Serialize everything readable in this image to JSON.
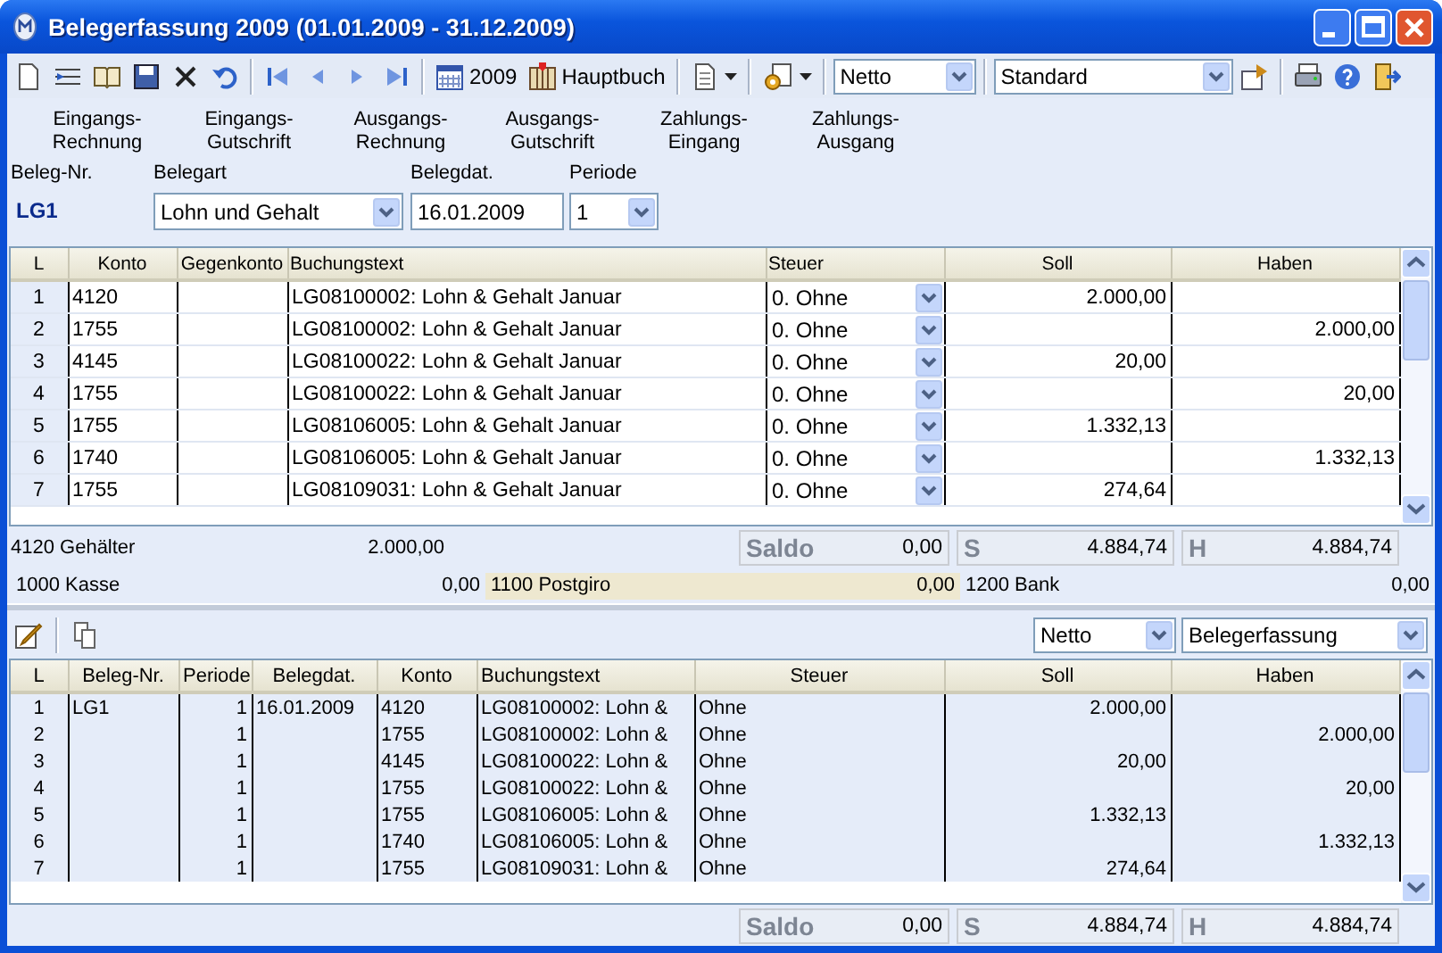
{
  "window": {
    "title": "Belegerfassung 2009 (01.01.2009 - 31.12.2009)"
  },
  "toolbar": {
    "year_button": "2009",
    "ledger_button": "Hauptbuch",
    "mode_select": "Netto",
    "layout_select": "Standard"
  },
  "document_types": [
    "Eingangs-Rechnung",
    "Eingangs-Gutschrift",
    "Ausgangs-Rechnung",
    "Ausgangs-Gutschrift",
    "Zahlungs-Eingang",
    "Zahlungs-Ausgang"
  ],
  "form": {
    "beleg_nr": {
      "label": "Beleg-Nr.",
      "value": "LG1"
    },
    "belegart": {
      "label": "Belegart",
      "value": "Lohn und Gehalt"
    },
    "belegdat": {
      "label": "Belegdat.",
      "value": "16.01.2009"
    },
    "periode": {
      "label": "Periode",
      "value": "1"
    }
  },
  "entry_table": {
    "columns": [
      "L",
      "Konto",
      "Gegenkonto",
      "Buchungstext",
      "Steuer",
      "Soll",
      "Haben"
    ],
    "rows": [
      {
        "l": "1",
        "konto": "4120",
        "gegenkonto": "",
        "text": "LG08100002: Lohn & Gehalt Januar",
        "steuer": "0. Ohne",
        "soll": "2.000,00",
        "haben": ""
      },
      {
        "l": "2",
        "konto": "1755",
        "gegenkonto": "",
        "text": "LG08100002: Lohn & Gehalt Januar",
        "steuer": "0. Ohne",
        "soll": "",
        "haben": "2.000,00"
      },
      {
        "l": "3",
        "konto": "4145",
        "gegenkonto": "",
        "text": "LG08100022: Lohn & Gehalt Januar",
        "steuer": "0. Ohne",
        "soll": "20,00",
        "haben": ""
      },
      {
        "l": "4",
        "konto": "1755",
        "gegenkonto": "",
        "text": "LG08100022: Lohn & Gehalt Januar",
        "steuer": "0. Ohne",
        "soll": "",
        "haben": "20,00"
      },
      {
        "l": "5",
        "konto": "1755",
        "gegenkonto": "",
        "text": "LG08106005: Lohn & Gehalt Januar",
        "steuer": "0. Ohne",
        "soll": "1.332,13",
        "haben": ""
      },
      {
        "l": "6",
        "konto": "1740",
        "gegenkonto": "",
        "text": "LG08106005: Lohn & Gehalt Januar",
        "steuer": "0. Ohne",
        "soll": "",
        "haben": "1.332,13"
      },
      {
        "l": "7",
        "konto": "1755",
        "gegenkonto": "",
        "text": "LG08109031: Lohn & Gehalt Januar",
        "steuer": "0. Ohne",
        "soll": "274,64",
        "haben": ""
      }
    ]
  },
  "account_balance": {
    "label": "4120 Gehälter",
    "value": "2.000,00"
  },
  "entry_totals": {
    "saldo": {
      "label": "Saldo",
      "value": "0,00"
    },
    "soll": {
      "label": "S",
      "value": "4.884,74"
    },
    "haben": {
      "label": "H",
      "value": "4.884,74"
    }
  },
  "cash_accounts": [
    {
      "label": "1000 Kasse",
      "value": "0,00",
      "selected": false
    },
    {
      "label": "1100 Postgiro",
      "value": "0,00",
      "selected": true
    },
    {
      "label": "1200 Bank",
      "value": "0,00",
      "selected": false
    }
  ],
  "journal_toolbar": {
    "mode_select": "Netto",
    "view_select": "Belegerfassung"
  },
  "journal_table": {
    "columns": [
      "L",
      "Beleg-Nr.",
      "Periode",
      "Belegdat.",
      "Konto",
      "Buchungstext",
      "Steuer",
      "Soll",
      "Haben"
    ],
    "rows": [
      {
        "l": "1",
        "beleg_nr": "LG1",
        "periode": "1",
        "belegdat": "16.01.2009",
        "konto": "4120",
        "text": "LG08100002: Lohn &",
        "steuer": "Ohne",
        "soll": "2.000,00",
        "haben": ""
      },
      {
        "l": "2",
        "beleg_nr": "",
        "periode": "1",
        "belegdat": "",
        "konto": "1755",
        "text": "LG08100002: Lohn &",
        "steuer": "Ohne",
        "soll": "",
        "haben": "2.000,00"
      },
      {
        "l": "3",
        "beleg_nr": "",
        "periode": "1",
        "belegdat": "",
        "konto": "4145",
        "text": "LG08100022: Lohn &",
        "steuer": "Ohne",
        "soll": "20,00",
        "haben": ""
      },
      {
        "l": "4",
        "beleg_nr": "",
        "periode": "1",
        "belegdat": "",
        "konto": "1755",
        "text": "LG08100022: Lohn &",
        "steuer": "Ohne",
        "soll": "",
        "haben": "20,00"
      },
      {
        "l": "5",
        "beleg_nr": "",
        "periode": "1",
        "belegdat": "",
        "konto": "1755",
        "text": "LG08106005: Lohn &",
        "steuer": "Ohne",
        "soll": "1.332,13",
        "haben": ""
      },
      {
        "l": "6",
        "beleg_nr": "",
        "periode": "1",
        "belegdat": "",
        "konto": "1740",
        "text": "LG08106005: Lohn &",
        "steuer": "Ohne",
        "soll": "",
        "haben": "1.332,13"
      },
      {
        "l": "7",
        "beleg_nr": "",
        "periode": "1",
        "belegdat": "",
        "konto": "1755",
        "text": "LG08109031: Lohn &",
        "steuer": "Ohne",
        "soll": "274,64",
        "haben": ""
      }
    ]
  },
  "journal_totals": {
    "saldo": {
      "label": "Saldo",
      "value": "0,00"
    },
    "soll": {
      "label": "S",
      "value": "4.884,74"
    },
    "haben": {
      "label": "H",
      "value": "4.884,74"
    }
  }
}
